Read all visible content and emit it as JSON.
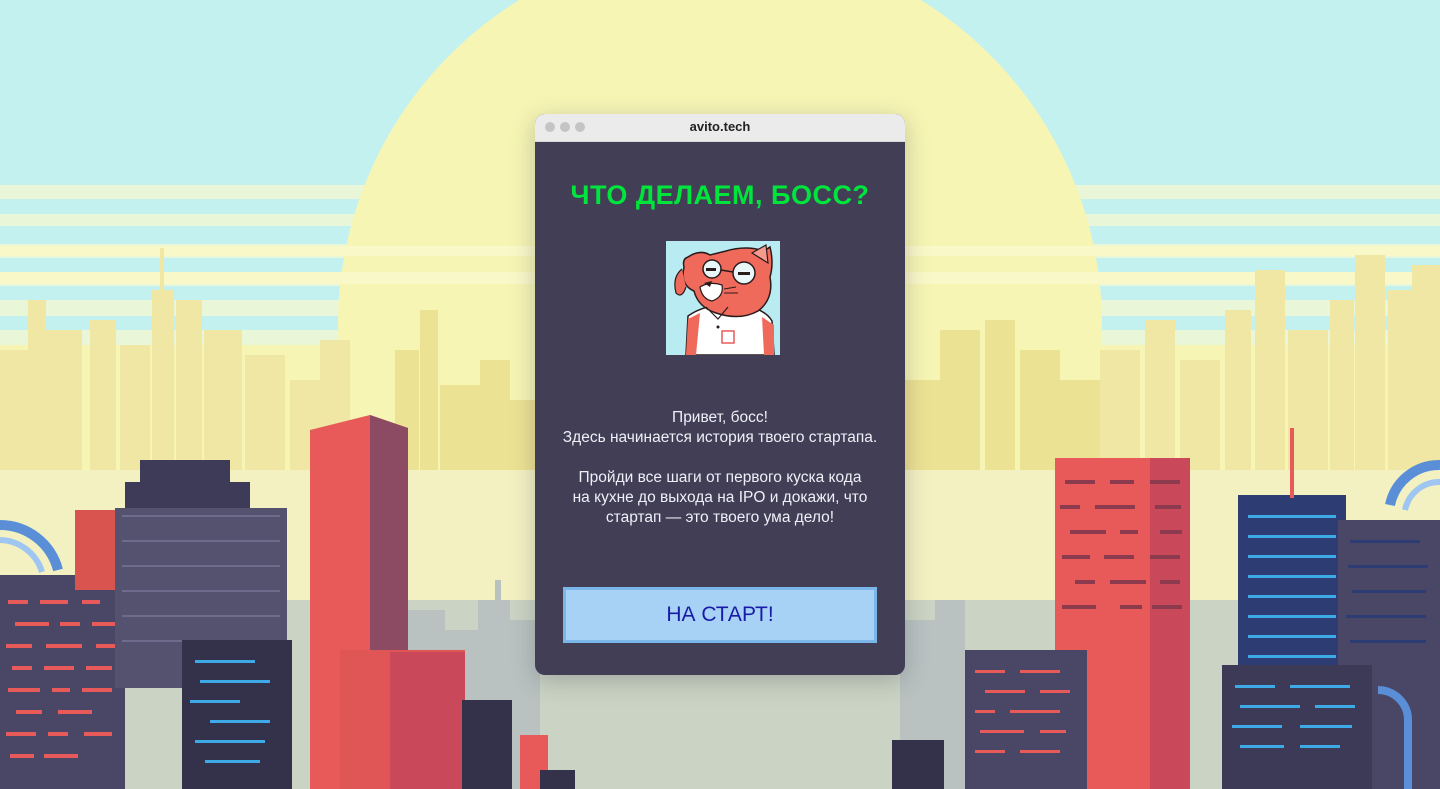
{
  "window": {
    "title": "avito.tech"
  },
  "game": {
    "heading": "ЧТО ДЕЛАЕМ, БОСС?",
    "intro_lines_1": [
      "Привет, босс!",
      "Здесь начинается история твоего стартапа."
    ],
    "intro_lines_2": [
      "Пройди все шаги от первого куска кода",
      "на кухне до выхода на IPO и докажи, что",
      "стартап — это твоего ума дело!"
    ],
    "start_button": "НА СТАРТ!"
  },
  "colors": {
    "sky": "#c3f1f0",
    "sun": "#f6f5b4",
    "window_bg": "#413e56",
    "heading": "#00e53c",
    "button_bg": "#a7d2f6",
    "button_text": "#1a1aa8",
    "building_red": "#e85a5a",
    "building_navy": "#4a4766"
  },
  "icons": {
    "avatar": "red-cat-boss-avatar",
    "window_controls": "window-control-dots"
  }
}
